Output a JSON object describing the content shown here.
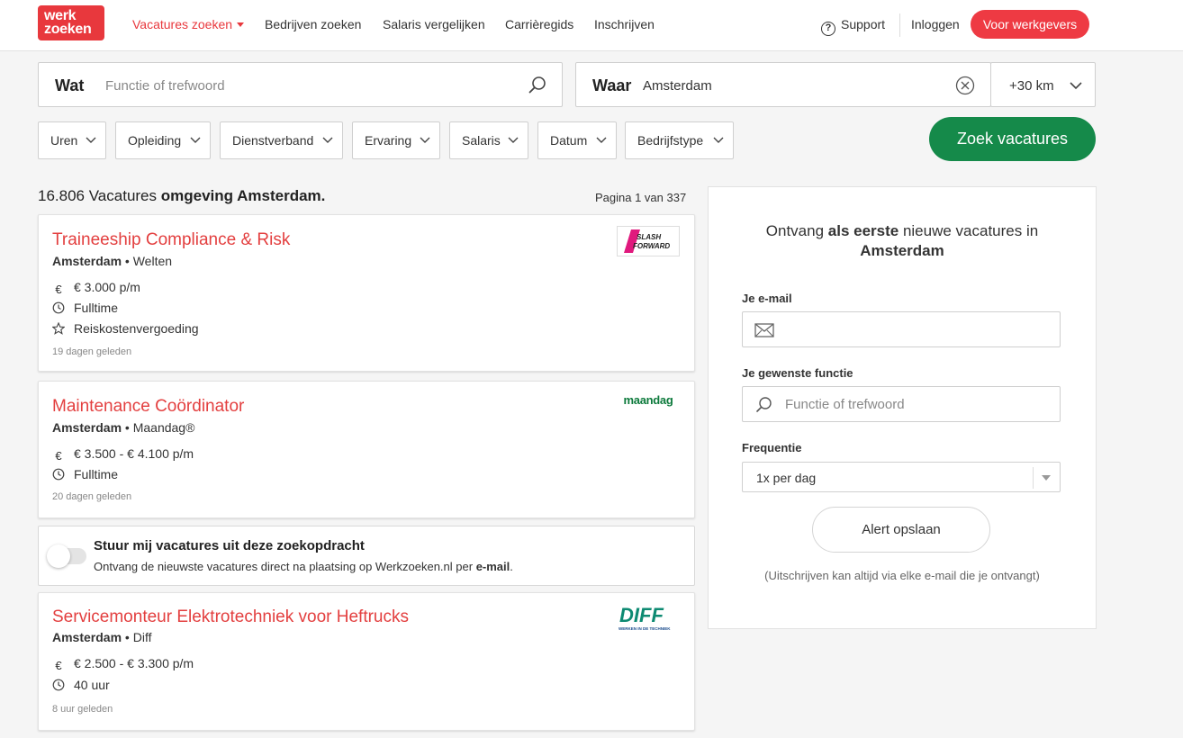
{
  "header": {
    "logo_line1": "werk",
    "logo_line2": "zoeken",
    "nav": [
      {
        "label": "Vacatures zoeken",
        "active": true
      },
      {
        "label": "Bedrijven zoeken"
      },
      {
        "label": "Salaris vergelijken"
      },
      {
        "label": "Carrièregids"
      },
      {
        "label": "Inschrijven"
      }
    ],
    "support_label": "Support",
    "login_label": "Inloggen",
    "employers_label": "Voor werkgevers"
  },
  "search": {
    "wat_label": "Wat",
    "wat_placeholder": "Functie of trefwoord",
    "waar_label": "Waar",
    "waar_value": "Amsterdam",
    "radius": "+30 km",
    "button_label": "Zoek vacatures"
  },
  "filters": [
    "Uren",
    "Opleiding",
    "Dienstverband",
    "Ervaring",
    "Salaris",
    "Datum",
    "Bedrijfstype"
  ],
  "results": {
    "count": "16.806",
    "label": "Vacatures",
    "location_text": "omgeving Amsterdam",
    "period": ".",
    "page_info": "Pagina 1 van 337"
  },
  "jobs": [
    {
      "title": "Traineeship Compliance & Risk",
      "city": "Amsterdam",
      "company": "Welten",
      "salary": "€ 3.000 p/m",
      "hours": "Fulltime",
      "benefit": "Reiskostenvergoeding",
      "date": "19 dagen geleden",
      "logo_text1": "SLASH",
      "logo_text2": "FORWARD"
    },
    {
      "title": "Maintenance Coördinator",
      "city": "Amsterdam",
      "company": "Maandag®",
      "salary": "€ 3.500 - € 4.100 p/m",
      "hours": "Fulltime",
      "date": "20 dagen geleden",
      "logo_text1": "maandag"
    },
    {
      "title": "Servicemonteur Elektrotechniek voor Heftrucks",
      "city": "Amsterdam",
      "company": "Diff",
      "salary": "€ 2.500 - € 3.300 p/m",
      "hours": "40 uur",
      "date": "8 uur geleden",
      "logo_text1": "DIFF",
      "logo_text2": "WERKEN IN DE TECHNIEK"
    }
  ],
  "alert_toggle": {
    "title": "Stuur mij vacatures uit deze zoekopdracht",
    "subtitle_prefix": "Ontvang de nieuwste vacatures direct na plaatsing op Werkzoeken.nl per",
    "subtitle_bold": "e-mail",
    "subtitle_suffix": "."
  },
  "panel": {
    "heading_prefix": "Ontvang",
    "heading_bold": "als eerste",
    "heading_suffix": "nieuwe vacatures in",
    "heading_city": "Amsterdam",
    "email_label": "Je e-mail",
    "function_label": "Je gewenste functie",
    "function_placeholder": "Functie of trefwoord",
    "frequency_label": "Frequentie",
    "frequency_value": "1x per dag",
    "save_label": "Alert opslaan",
    "note": "(Uitschrijven kan altijd via elke e-mail die je ontvangt)"
  },
  "colors": {
    "brand_red": "#e8383d",
    "title_red": "#e33f3f",
    "search_green": "#158a4a"
  },
  "icons": [
    "search-icon",
    "clear-icon",
    "chevron-down-icon",
    "question-icon",
    "euro-icon",
    "clock-icon",
    "star-icon",
    "mail-icon",
    "caret-down-icon"
  ]
}
